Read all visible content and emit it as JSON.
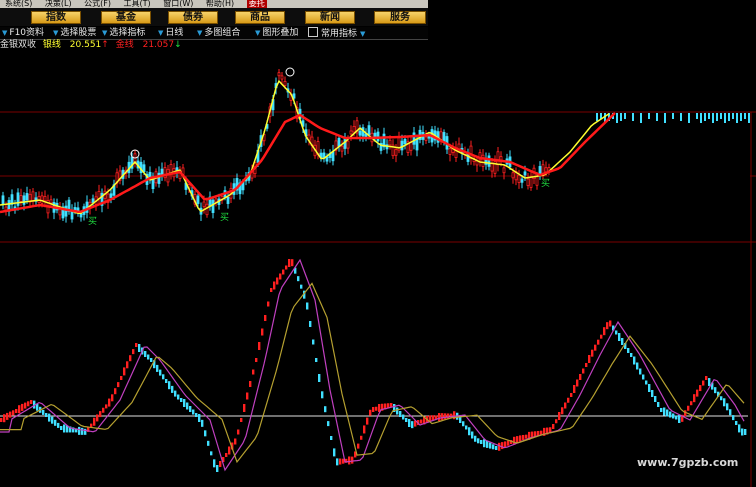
{
  "menubar": {
    "items": [
      "系统(S)",
      "决策(L)",
      "公式(F)",
      "工具(T)",
      "窗口(W)",
      "帮助(H)"
    ],
    "active": "委托"
  },
  "navbar": {
    "buttons": [
      "指数",
      "基金",
      "债券",
      "商品",
      "新闻",
      "服务"
    ]
  },
  "toolbar": {
    "items": [
      "F10资料",
      "选择股票",
      "选择指标",
      "日线",
      "多图组合",
      "图形叠加",
      "常用指标"
    ]
  },
  "indicator": {
    "name": "金银双收",
    "label1": "银线",
    "value1": "20.551",
    "arrow1": "↑",
    "label2": "金线",
    "value2": "21.057",
    "arrow2": "↓"
  },
  "signals": {
    "buy": "买"
  },
  "watermark": "www.7gpzb.com",
  "colors": {
    "up": "#ff2020",
    "down": "#40e0ff",
    "yellow": "#ffff30",
    "redline": "#ff1a1a",
    "purple": "#c040c0",
    "olive": "#b5a030",
    "zero": "#e0e0e0",
    "panelline": "#8a0000"
  }
}
